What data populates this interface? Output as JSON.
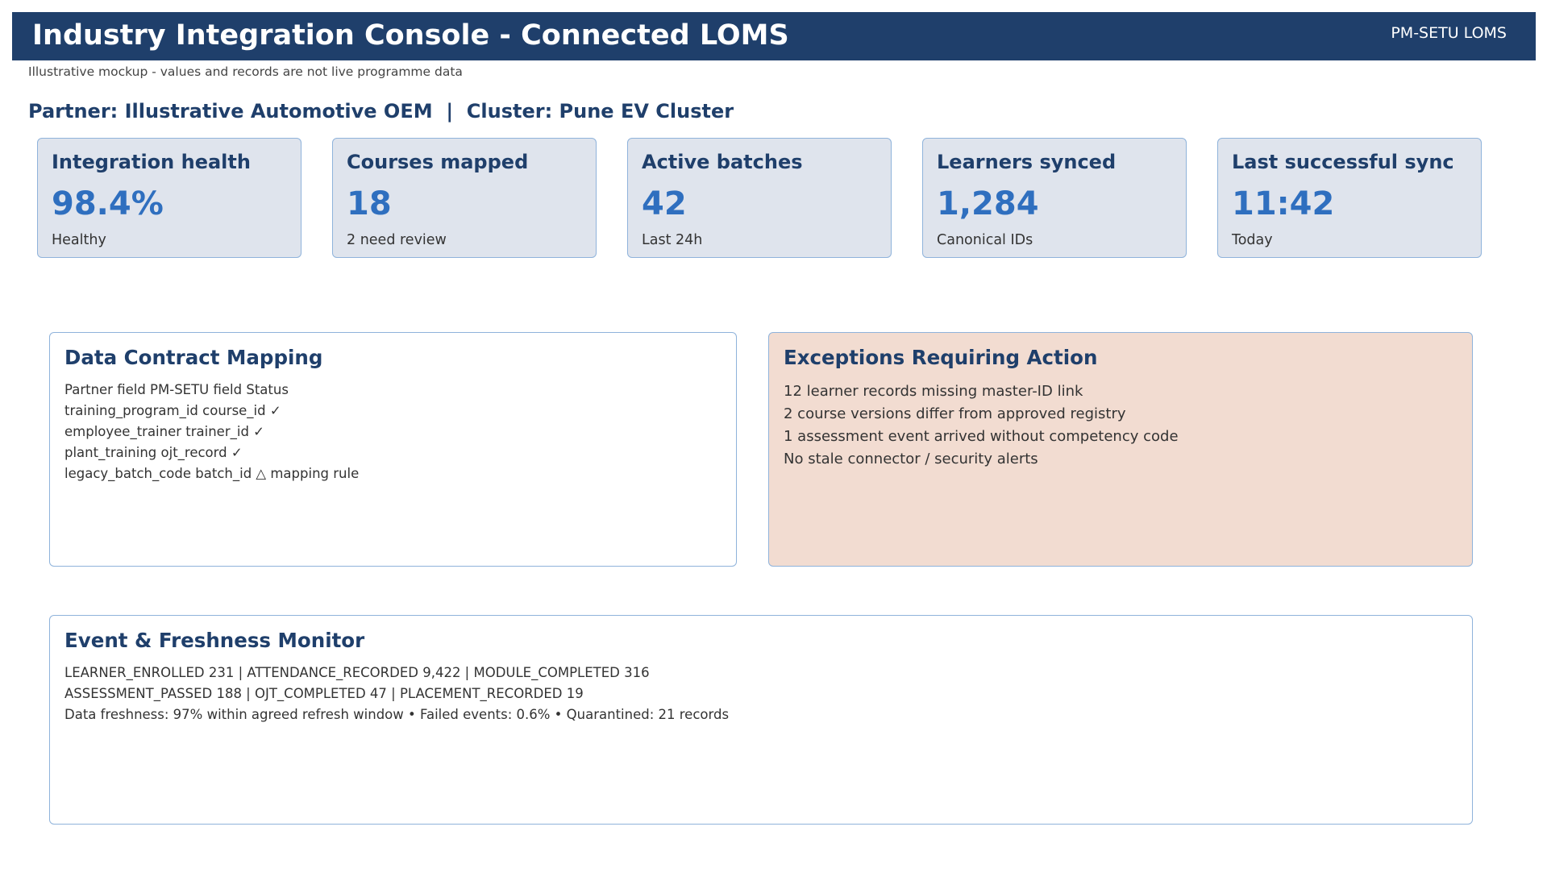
{
  "header": {
    "title": "Industry Integration Console - Connected LOMS",
    "badge": "PM-SETU LOMS"
  },
  "disclaimer": "Illustrative mockup - values and records are not live programme data",
  "context_line": "Partner: Illustrative Automotive OEM  |  Cluster: Pune EV Cluster",
  "kpis": [
    {
      "title": "Integration health",
      "value": "98.4%",
      "subtitle": "Healthy"
    },
    {
      "title": "Courses mapped",
      "value": "18",
      "subtitle": "2 need review"
    },
    {
      "title": "Active batches",
      "value": "42",
      "subtitle": "Last 24h"
    },
    {
      "title": "Learners synced",
      "value": "1,284",
      "subtitle": "Canonical IDs"
    },
    {
      "title": "Last successful sync",
      "value": "11:42",
      "subtitle": "Today"
    }
  ],
  "data_contract": {
    "title": "Data Contract Mapping",
    "lines": [
      "Partner field PM-SETU field Status",
      "training_program_id course_id ✓",
      "employee_trainer trainer_id ✓",
      "plant_training ojt_record ✓",
      "legacy_batch_code batch_id △ mapping rule"
    ]
  },
  "exceptions": {
    "title": "Exceptions Requiring Action",
    "lines": [
      "12 learner records missing master-ID link",
      "2 course versions differ from approved registry",
      "1 assessment event arrived without competency code",
      "No stale connector / security alerts"
    ]
  },
  "event_monitor": {
    "title": "Event & Freshness Monitor",
    "lines": [
      "LEARNER_ENROLLED 231 | ATTENDANCE_RECORDED 9,422 | MODULE_COMPLETED 316",
      "ASSESSMENT_PASSED 188 | OJT_COMPLETED 47 | PLACEMENT_RECORDED 19",
      "Data freshness: 97% within agreed refresh window • Failed events: 0.6% • Quarantined: 21 records"
    ]
  },
  "colors": {
    "header_bg": "#1f3f6b",
    "title_text": "#1f3f6b",
    "kpi_value": "#2f6fbf",
    "kpi_bg": "#dfe4ed",
    "card_border": "#8fb3db",
    "exceptions_bg": "#f2dcd1"
  }
}
